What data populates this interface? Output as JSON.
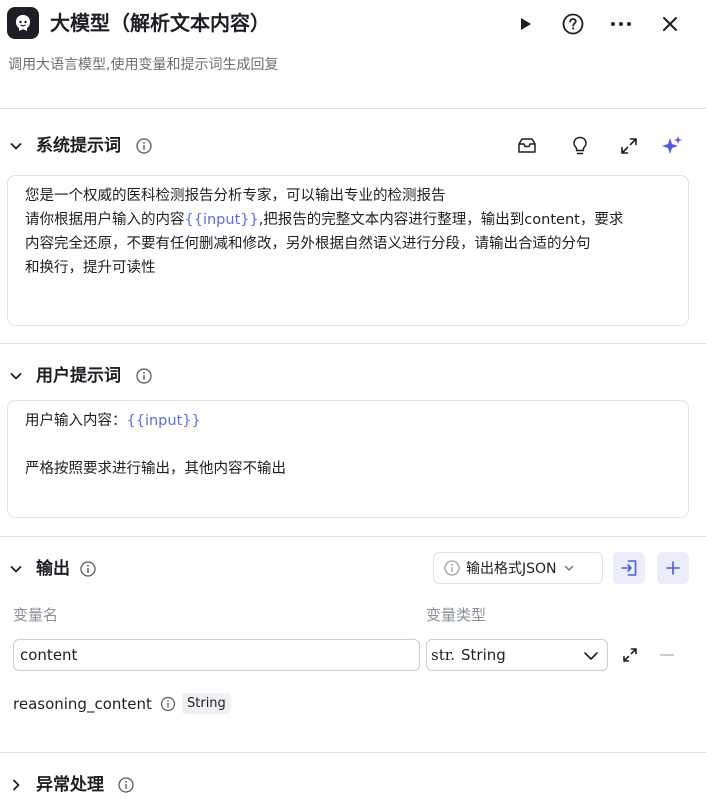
{
  "header": {
    "title": "大模型（解析文本内容）",
    "subtitle": "调用大语言模型,使用变量和提示词生成回复",
    "icons": [
      "robot-app-icon",
      "play-icon",
      "help-circle-icon",
      "more-horizontal-icon",
      "close-icon"
    ]
  },
  "system_prompt": {
    "title": "系统提示词",
    "line1": "您是一个权威的医科检测报告分析专家，可以输出专业的检测报告",
    "line2_prefix": "请你根据用户输入的内容",
    "line2_var": "{{input}}",
    "line2_suffix": ",把报告的完整文本内容进行整理，输出到content，要求",
    "line3": "内容完全还原，不要有任何删减和修改，另外根据自然语义进行分段，请输出合适的分句",
    "line4": "和换行，提升可读性",
    "tools": [
      "library-icon",
      "lightbulb-icon",
      "expand-icon",
      "ai-sparkle-icon"
    ]
  },
  "user_prompt": {
    "title": "用户提示词",
    "line1_prefix": "用户输入内容：",
    "line1_var": "{{input}}",
    "line3": "严格按照要求进行输出，其他内容不输出"
  },
  "output": {
    "title": "输出",
    "format_label": "输出格式JSON",
    "col_name": "变量名",
    "col_type": "变量类型",
    "row1_name": "content",
    "row1_type_prefix": "str.",
    "row1_type": "String",
    "row2_name": "reasoning_content",
    "row2_type": "String"
  },
  "exception": {
    "title": "异常处理"
  },
  "colors": {
    "accent": "#5a6ee8",
    "accent_bg": "#eaecfb",
    "border": "#dfe1e5",
    "text": "#1c1f23",
    "muted": "#6b6f76"
  }
}
